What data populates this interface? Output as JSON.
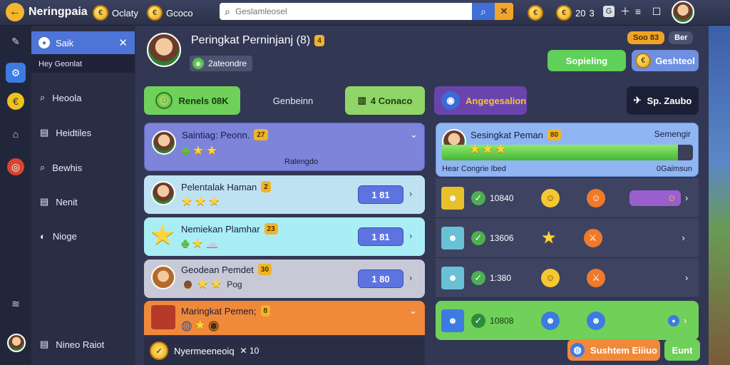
{
  "topbar": {
    "app_title": "Neringpaia",
    "currency1": "Oclaty",
    "currency2": "Gcoco",
    "search_placeholder": "Geslamleosel",
    "counter_a": "20",
    "counter_b": "3"
  },
  "sidebar": {
    "header_label": "Saik",
    "sub_label": "Hey Geonlat",
    "items": [
      {
        "label": "Heoola",
        "icon": "search-icon"
      },
      {
        "label": "Heidtiles",
        "icon": "list-icon"
      },
      {
        "label": "Bewhis",
        "icon": "search-icon"
      },
      {
        "label": "Nenit",
        "icon": "list-icon"
      },
      {
        "label": "Nioge",
        "icon": "chat-icon"
      }
    ],
    "footer_label": "Nineo Raiot"
  },
  "header": {
    "title": "Peringkat Perninjanj (8)",
    "title_badge": "4",
    "subtitle_pill": "2ateondre",
    "top_right_badge": "Soo 83",
    "top_right_label": "Ber",
    "btn_primary": "Sopieling",
    "btn_secondary": "Geshteol"
  },
  "tabs": {
    "tab1": "Renels 08K",
    "tab2": "Genbeinn",
    "tab3": "4 Conaco",
    "tab4": "Angegesalion",
    "tab5": "Sp. Zaubo"
  },
  "leaderboard_left": [
    {
      "name": "Saintiag: Peonn.",
      "badge": "27",
      "sub": "Ralengdo",
      "color": "#7a82d8"
    },
    {
      "name": "Pelentalak Haman",
      "badge": "2",
      "value": "1 81",
      "color": "#bfe2f2"
    },
    {
      "name": "Nemiekan Plamhar",
      "badge": "23",
      "value": "1 81",
      "color": "#a9eef4"
    },
    {
      "name": "Geodean Pemdet",
      "badge": "30",
      "sub": "Pog",
      "value": "1 80",
      "color": "#c7cad6"
    },
    {
      "name": "Maringkat Pemen;",
      "badge": "8",
      "color": "#f0893a"
    }
  ],
  "footer_left": {
    "label": "Nyermeeneoiq",
    "count": "10"
  },
  "progress_card": {
    "title": "Sesingkat Peman",
    "badge": "80",
    "right_label": "Semengir",
    "progress": 0.94,
    "foot_left": "Hear Congrie Ibed",
    "foot_right": "0Gaimsun"
  },
  "leaderboard_right": [
    {
      "score": "10840"
    },
    {
      "score": "13606"
    },
    {
      "score": "1:380"
    },
    {
      "score": "10808"
    }
  ],
  "footer_right": {
    "btn1": "Sushtem Eiiiuo",
    "btn2": "Eunt"
  },
  "colors": {
    "green": "#5fd05a",
    "blue": "#4d74d6",
    "orange": "#f0893a",
    "purple": "#7b4bb8"
  }
}
